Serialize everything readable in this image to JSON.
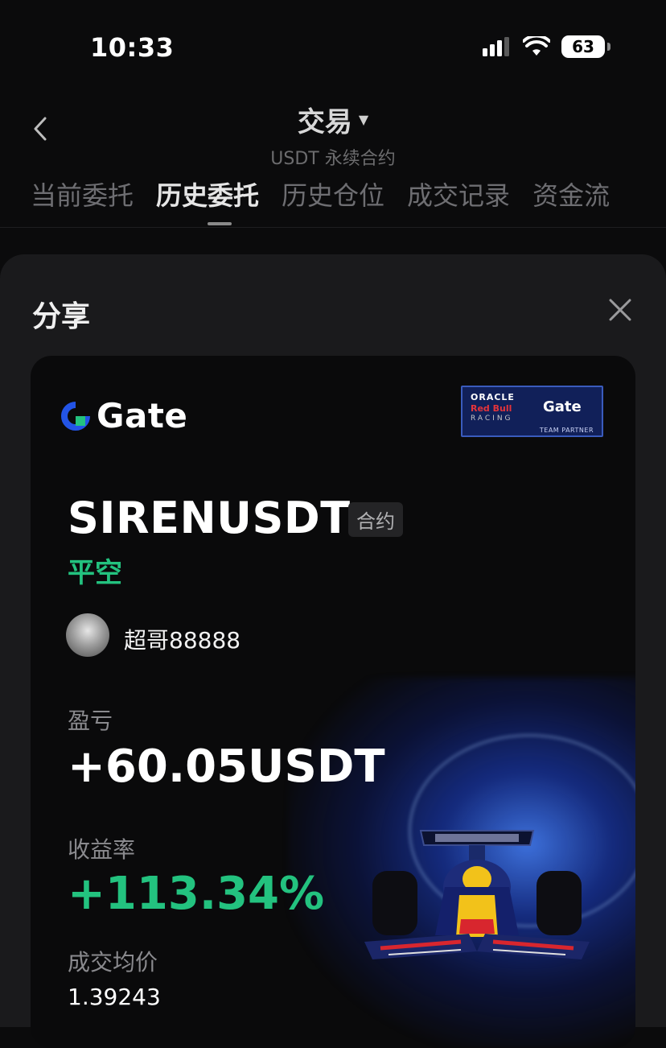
{
  "status_bar": {
    "time": "10:33",
    "battery": "63"
  },
  "nav": {
    "title": "交易",
    "subtitle": "USDT 永续合约",
    "tabs": [
      {
        "label": "当前委托",
        "active": false
      },
      {
        "label": "历史委托",
        "active": true
      },
      {
        "label": "历史仓位",
        "active": false
      },
      {
        "label": "成交记录",
        "active": false
      },
      {
        "label": "资金流",
        "active": false
      }
    ]
  },
  "sheet": {
    "title": "分享"
  },
  "card": {
    "brand": "Gate",
    "partner_badge": {
      "oracle": "ORACLE",
      "red_bull": "Red Bull",
      "racing": "RACING",
      "gate": "Gate",
      "team_partner": "TEAM PARTNER"
    },
    "symbol": "SIRENUSDT",
    "type_tag": "合约",
    "side": "平空",
    "username": "超哥88888",
    "pnl_label": "盈亏",
    "pnl_value": "+60.05USDT",
    "roi_label": "收益率",
    "roi_value": "+113.34%",
    "avg_price_label": "成交均价",
    "avg_price_value": "1.39243"
  },
  "colors": {
    "profit_green": "#23c27f",
    "gate_blue": "#2354e6",
    "background": "#0b0b0c"
  }
}
